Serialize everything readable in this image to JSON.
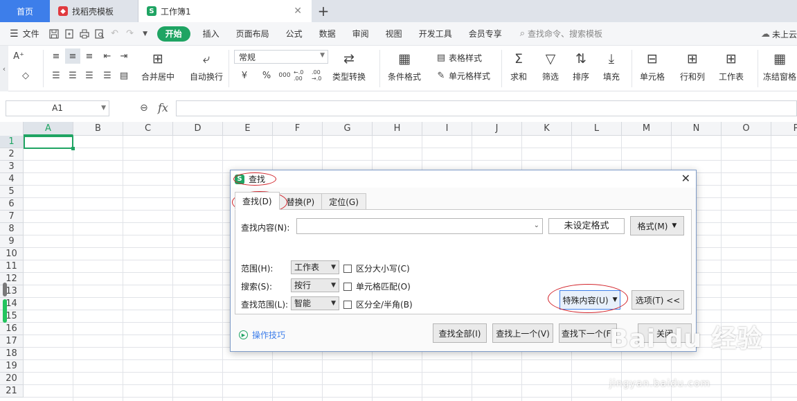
{
  "tabs": [
    {
      "label": "首页"
    },
    {
      "label": "找稻壳模板"
    },
    {
      "label": "工作簿1"
    }
  ],
  "menu": {
    "file": "文件",
    "items": [
      "开始",
      "插入",
      "页面布局",
      "公式",
      "数据",
      "审阅",
      "视图",
      "开发工具",
      "会员专享"
    ],
    "search_placeholder": "查找命令、搜索模板",
    "cloud": "未上云"
  },
  "ribbon": {
    "merge_center": "合并居中",
    "wrap_text": "自动换行",
    "number_format": "常规",
    "type_convert": "类型转换",
    "conditional_format": "条件格式",
    "table_style": "表格样式",
    "cell_style": "单元格样式",
    "sum": "求和",
    "filter": "筛选",
    "sort": "排序",
    "fill": "填充",
    "cell": "单元格",
    "row_col": "行和列",
    "worksheet": "工作表",
    "freeze": "冻结窗格",
    "currency_symbol": "¥",
    "percent_symbol": "%",
    "thousands_symbol": "000",
    "dec_increase": "←.0 .00",
    "dec_decrease": ".00 →.0"
  },
  "formula_bar": {
    "name_box": "A1",
    "fx": "fx"
  },
  "grid": {
    "columns": [
      "A",
      "B",
      "C",
      "D",
      "E",
      "F",
      "G",
      "H",
      "I",
      "J",
      "K",
      "L",
      "M",
      "N",
      "O",
      "P"
    ],
    "rows": [
      "1",
      "2",
      "3",
      "4",
      "5",
      "6",
      "7",
      "8",
      "9",
      "10",
      "11",
      "12",
      "13",
      "14",
      "15",
      "16",
      "17",
      "18",
      "19",
      "20",
      "21"
    ],
    "active_cell": "A1"
  },
  "dialog": {
    "title": "查找",
    "tabs": [
      "查找(D)",
      "替换(P)",
      "定位(G)"
    ],
    "find_label": "查找内容(N):",
    "find_value": "",
    "format_display": "未设定格式",
    "format_button": "格式(M)",
    "scope_label": "范围(H):",
    "scope_value": "工作表",
    "search_label": "搜索(S):",
    "search_value": "按行",
    "lookin_label": "查找范围(L):",
    "lookin_value": "智能",
    "match_case": "区分大小写(C)",
    "match_cell": "单元格匹配(O)",
    "match_width": "区分全/半角(B)",
    "special_button": "特殊内容(U)",
    "options_button": "选项(T) <<",
    "tips": "操作技巧",
    "find_all": "查找全部(I)",
    "find_prev": "查找上一个(V)",
    "find_next": "查找下一个(F)",
    "close": "关闭"
  },
  "watermark": {
    "main": "Bai du 经验",
    "sub": "jingyan.baidu.com"
  },
  "colors": {
    "accent_green": "#1fa463",
    "tab_blue": "#3d7eea",
    "annotation_red": "#d2232a"
  }
}
